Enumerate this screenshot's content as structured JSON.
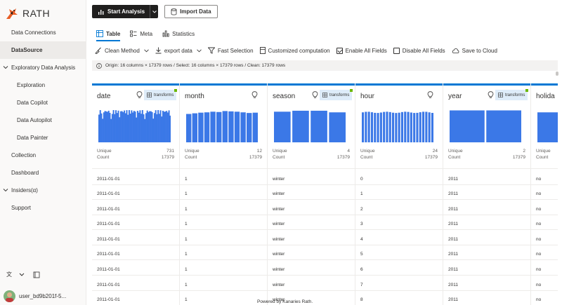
{
  "brand": {
    "name": "RATH"
  },
  "sidebar": {
    "items": [
      {
        "label": "Data Connections",
        "indent": 0,
        "active": false,
        "expander": false
      },
      {
        "label": "DataSource",
        "indent": 0,
        "active": true,
        "expander": false
      },
      {
        "label": "Exploratory Data Analysis",
        "indent": 0,
        "active": false,
        "expander": true
      },
      {
        "label": "Exploration",
        "indent": 1,
        "active": false,
        "expander": false
      },
      {
        "label": "Data Copilot",
        "indent": 1,
        "active": false,
        "expander": false
      },
      {
        "label": "Data Autopilot",
        "indent": 1,
        "active": false,
        "expander": false
      },
      {
        "label": "Data Painter",
        "indent": 1,
        "active": false,
        "expander": false
      },
      {
        "label": "Collection",
        "indent": 0,
        "active": false,
        "expander": false
      },
      {
        "label": "Dashboard",
        "indent": 0,
        "active": false,
        "expander": false
      },
      {
        "label": "Insiders(α)",
        "indent": 0,
        "active": false,
        "expander": true
      },
      {
        "label": "Support",
        "indent": 0,
        "active": false,
        "expander": false
      }
    ],
    "user": "user_bd9b201f-5..."
  },
  "topbar": {
    "start_analysis": "Start Analysis",
    "import_data": "Import Data"
  },
  "tabs": [
    {
      "label": "Table",
      "active": true,
      "icon": "table-icon"
    },
    {
      "label": "Meta",
      "active": false,
      "icon": "meta-icon"
    },
    {
      "label": "Statistics",
      "active": false,
      "icon": "statistics-icon"
    }
  ],
  "toolbar": {
    "clean_method": "Clean Method",
    "export_data": "export data",
    "fast_selection": "Fast Selection",
    "customized_computation": "Customized computation",
    "enable_all_fields": "Enable All Fields",
    "enable_all_checked": true,
    "disable_all_fields": "Disable All Fields",
    "disable_all_checked": false,
    "save_to_cloud": "Save to Cloud"
  },
  "info": {
    "text": "Origin: 16 columns × 17379 rows / Select: 16 columns × 17379 rows / Clean: 17379 rows"
  },
  "table": {
    "stat_labels": {
      "unique": "Unique",
      "count": "Count"
    },
    "transforms_label": "transforms",
    "columns": [
      {
        "name": "date",
        "unique": "731",
        "count": "17379",
        "transforms": true
      },
      {
        "name": "month",
        "unique": "12",
        "count": "17379",
        "transforms": false
      },
      {
        "name": "season",
        "unique": "4",
        "count": "17379",
        "transforms": true
      },
      {
        "name": "hour",
        "unique": "24",
        "count": "17379",
        "transforms": false
      },
      {
        "name": "year",
        "unique": "2",
        "count": "17379",
        "transforms": true
      },
      {
        "name": "holida",
        "unique": "",
        "count": "",
        "transforms": false
      }
    ],
    "rows": [
      [
        "2011-01-01",
        "1",
        "winter",
        "0",
        "2011",
        "no"
      ],
      [
        "2011-01-01",
        "1",
        "winter",
        "1",
        "2011",
        "no"
      ],
      [
        "2011-01-01",
        "1",
        "winter",
        "2",
        "2011",
        "no"
      ],
      [
        "2011-01-01",
        "1",
        "winter",
        "3",
        "2011",
        "no"
      ],
      [
        "2011-01-01",
        "1",
        "winter",
        "4",
        "2011",
        "no"
      ],
      [
        "2011-01-01",
        "1",
        "winter",
        "5",
        "2011",
        "no"
      ],
      [
        "2011-01-01",
        "1",
        "winter",
        "6",
        "2011",
        "no"
      ],
      [
        "2011-01-01",
        "1",
        "winter",
        "7",
        "2011",
        "no"
      ],
      [
        "2011-01-01",
        "1",
        "winter",
        "8",
        "2011",
        "no"
      ]
    ]
  },
  "footer": "Powered by Kanaries Rath.",
  "colors": {
    "accent": "#0078d4",
    "bar": "#3b78e7",
    "transform_bg": "#deecf9",
    "active_nav": "#edebe9"
  }
}
